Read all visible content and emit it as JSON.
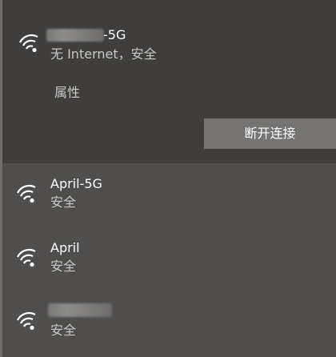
{
  "connected_network": {
    "ssid_visible_suffix": "-5G",
    "status": "无 Internet，安全",
    "properties_label": "属性",
    "disconnect_label": "断开连接",
    "icon": "wifi-full-icon"
  },
  "networks": [
    {
      "ssid": "April-5G",
      "status": "安全",
      "icon": "wifi-full-icon"
    },
    {
      "ssid": "April",
      "status": "安全",
      "icon": "wifi-full-icon"
    },
    {
      "ssid": "",
      "status": "安全",
      "icon": "wifi-full-icon"
    }
  ],
  "colors": {
    "flyout_bg": "#4f4e4d",
    "selected_bg": "#3f3e3d",
    "button_bg": "#757472",
    "secondary_text": "#c9c8c6",
    "primary_text": "#ffffff"
  }
}
